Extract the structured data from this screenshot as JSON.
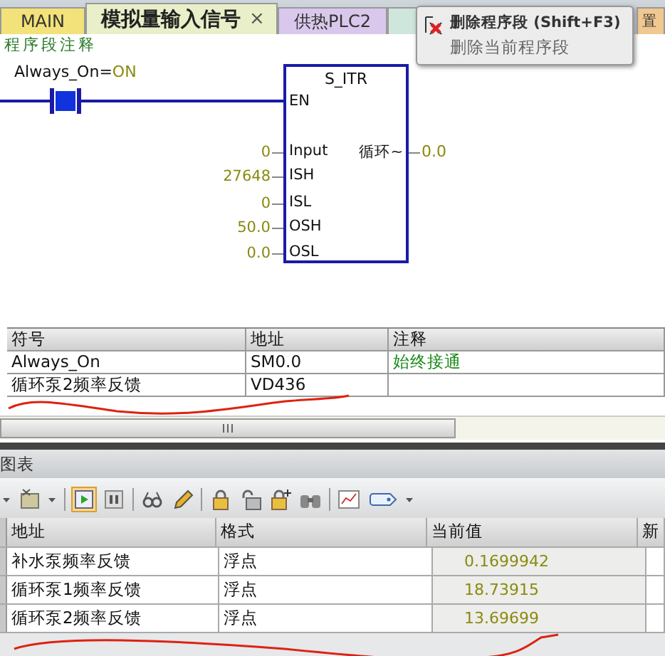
{
  "tabs": [
    {
      "label": "MAIN",
      "selected": false,
      "color": "#f3e27a"
    },
    {
      "label": "模拟量输入信号",
      "selected": true,
      "color": "#e9efc8",
      "close": "×"
    },
    {
      "label": "供热PLC2",
      "selected": false,
      "color": "#d9c8ec"
    },
    {
      "selected": false,
      "color": "#cfe6dc"
    },
    {
      "label": "置",
      "selected": false,
      "color": "#f0c890"
    }
  ],
  "tooltip": {
    "title": "删除程序段 (Shift+F3)",
    "description": "删除当前程序段"
  },
  "network_comment": "程序段注释",
  "ladder": {
    "contact": {
      "label": "Always_On=",
      "state": "ON",
      "on": true
    },
    "block": {
      "name": "S_ITR",
      "enable": "EN",
      "output": {
        "name": "循环~",
        "value": "0.0"
      },
      "inputs": [
        {
          "name": "Input",
          "value": "0"
        },
        {
          "name": "ISH",
          "value": "27648"
        },
        {
          "name": "ISL",
          "value": "0"
        },
        {
          "name": "OSH",
          "value": "50.0"
        },
        {
          "name": "OSL",
          "value": "0.0"
        }
      ]
    }
  },
  "symbol_table": {
    "columns": [
      "符号",
      "地址",
      "注释"
    ],
    "rows": [
      [
        "Always_On",
        "SM0.0",
        "始终接通"
      ],
      [
        "循环泵2频率反馈",
        "VD436",
        ""
      ]
    ]
  },
  "chart_panel": {
    "title": "图表",
    "columns": [
      "地址",
      "格式",
      "当前值",
      "新"
    ],
    "rows": [
      [
        "补水泵频率反馈",
        "浮点",
        "0.1699942"
      ],
      [
        "循环泵1频率反馈",
        "浮点",
        "18.73915"
      ],
      [
        "循环泵2频率反馈",
        "浮点",
        "13.69699"
      ]
    ]
  }
}
